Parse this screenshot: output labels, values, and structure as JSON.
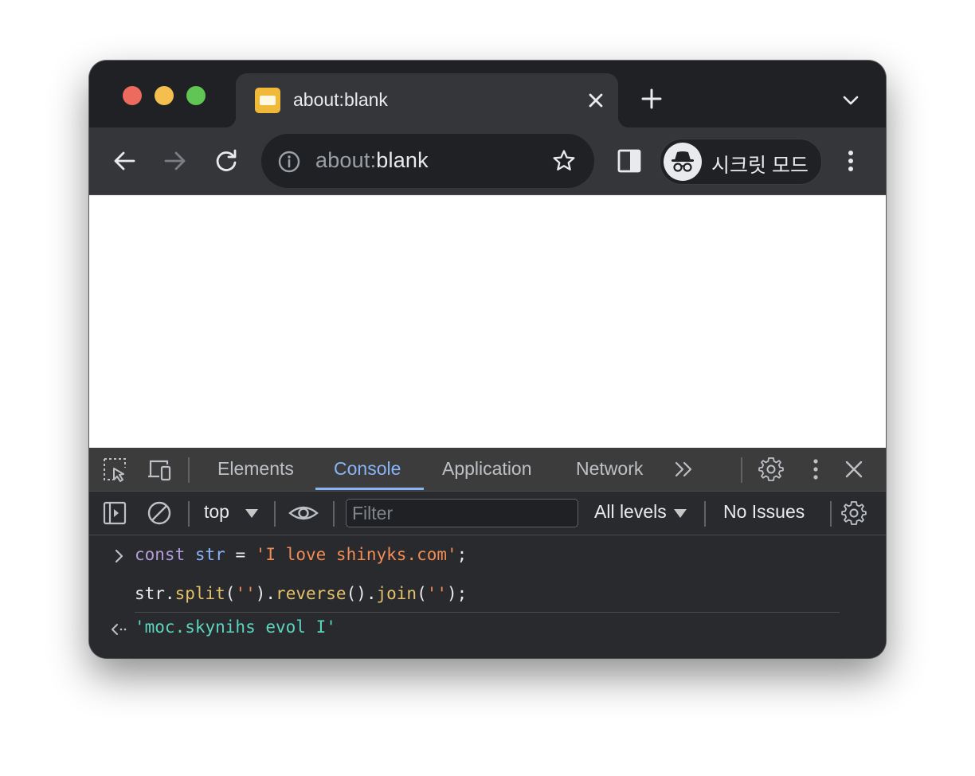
{
  "tab": {
    "title": "about:blank",
    "close_label": "close-tab"
  },
  "omnibox": {
    "dim_part": "about:",
    "bright_part": "blank"
  },
  "incognito": {
    "label": "시크릿 모드"
  },
  "devtools": {
    "tabs": [
      {
        "label": "Elements",
        "active": false
      },
      {
        "label": "Console",
        "active": true
      },
      {
        "label": "Application",
        "active": false
      },
      {
        "label": "Network",
        "active": false
      }
    ],
    "toolbar": {
      "context": "top",
      "filter_placeholder": "Filter",
      "levels": "All levels",
      "issues": "No Issues"
    },
    "console": {
      "input_line1": {
        "kw": "const",
        "var": "str",
        "op": "=",
        "str": "'I love shinyks.com'",
        "end": ";"
      },
      "input_line2": {
        "obj": "str.",
        "fn1": "split",
        "p1": "(",
        "arg1": "''",
        "p2": ").",
        "fn2": "reverse",
        "p3": "().",
        "fn3": "join",
        "p4": "(",
        "arg3": "''",
        "p5": ");"
      },
      "result": "'moc.skynihs evol I'"
    }
  },
  "colors": {
    "accent": "#8ab4f8",
    "string": "#f28b54",
    "keyword": "#b39ddb",
    "function": "#e3c26b",
    "result": "#5cd5c1"
  }
}
